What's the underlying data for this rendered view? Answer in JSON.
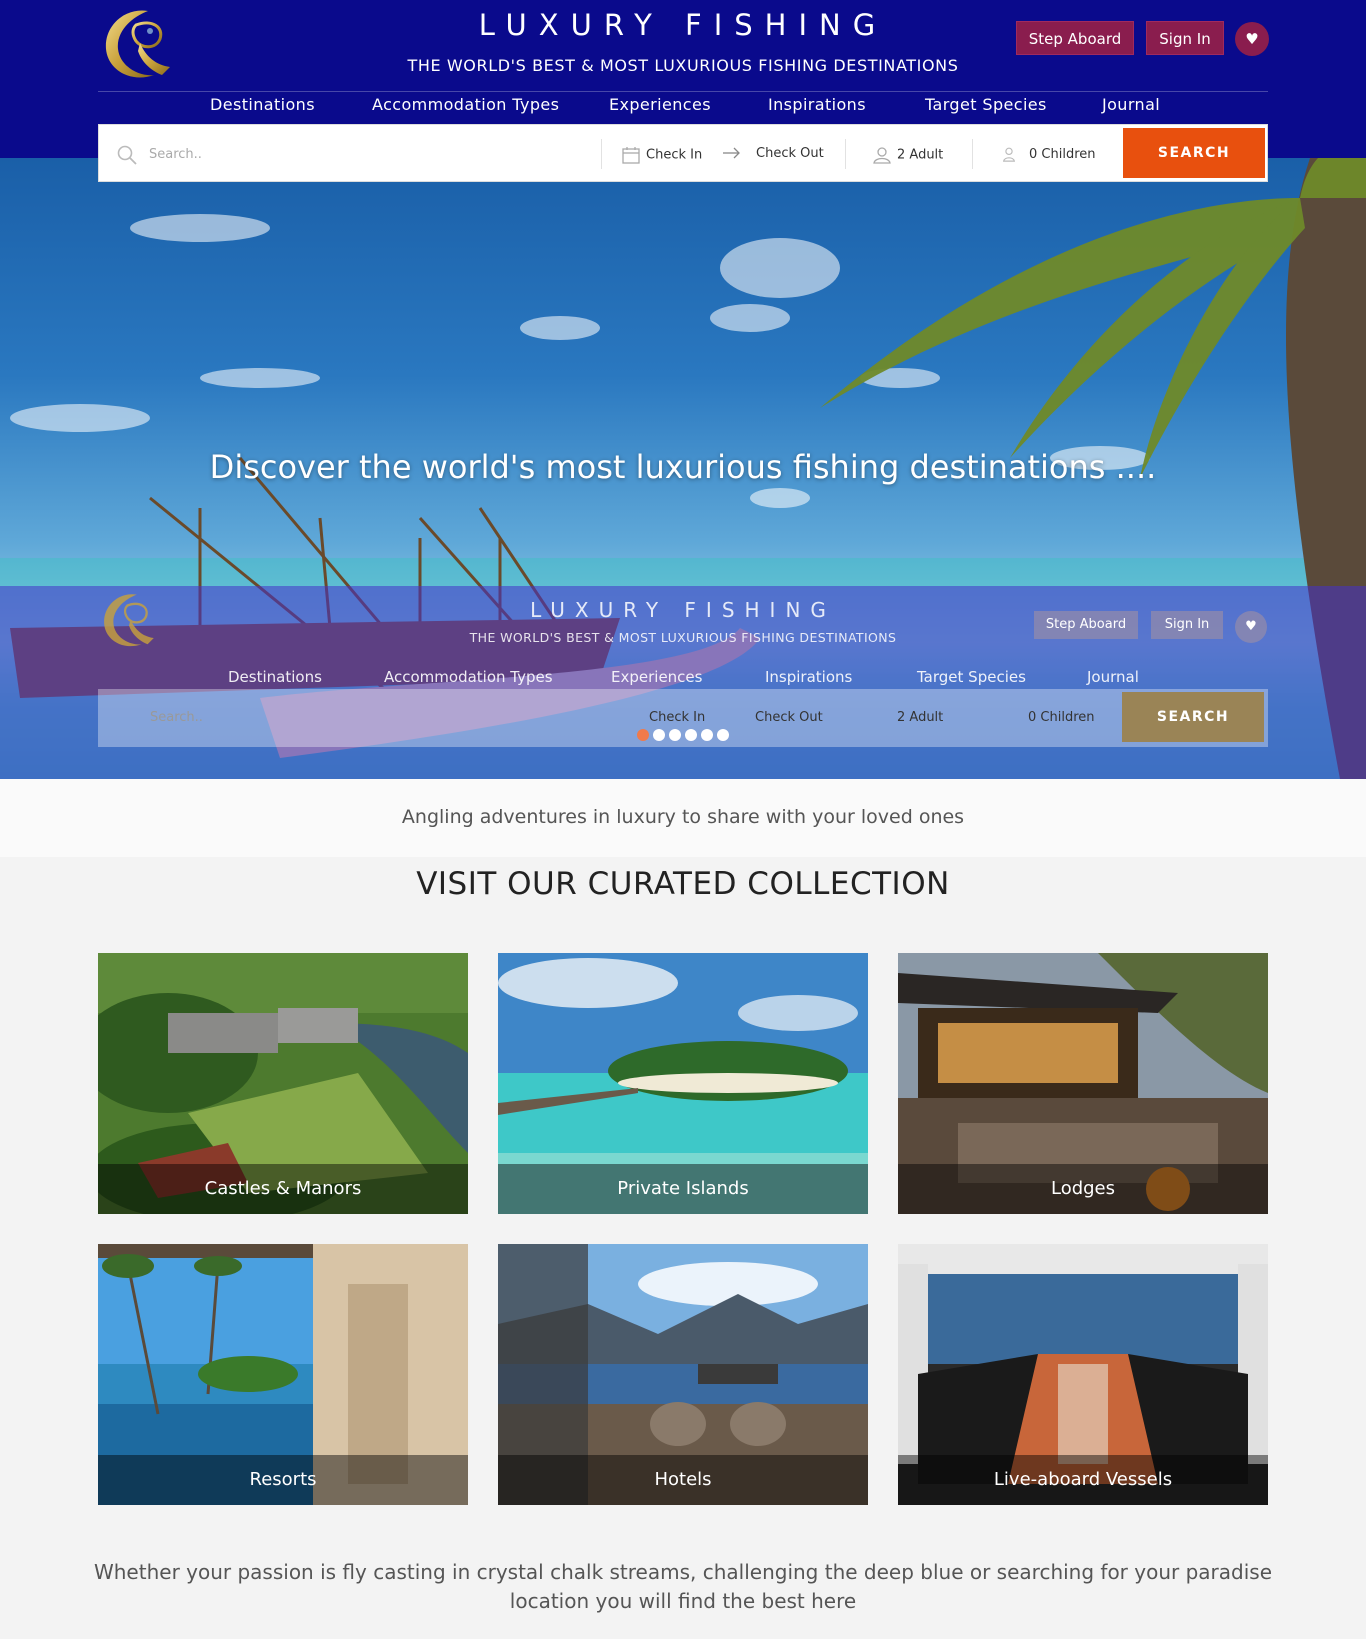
{
  "brand": {
    "title": "LUXURY FISHING",
    "subtitle": "THE WORLD'S BEST & MOST LUXURIOUS FISHING DESTINATIONS",
    "logo_icon": "fish-crest-logo-icon"
  },
  "header": {
    "step_aboard_label": "Step Aboard",
    "sign_in_label": "Sign In",
    "favorites_icon": "heart-icon"
  },
  "nav": {
    "items": [
      {
        "label": "Destinations"
      },
      {
        "label": "Accommodation Types"
      },
      {
        "label": "Experiences"
      },
      {
        "label": "Inspirations"
      },
      {
        "label": "Target Species"
      },
      {
        "label": "Journal"
      }
    ]
  },
  "search": {
    "placeholder": "Search..",
    "check_in": "Check In",
    "check_out": "Check Out",
    "adults": "2 Adult",
    "children": "0 Children",
    "button_label": "SEARCH"
  },
  "hero": {
    "heading": "Discover the world's most luxurious fishing destinations ....",
    "slide_count": 6,
    "active_slide": 1
  },
  "tagline": "Angling adventures in luxury to share with your loved ones",
  "collection": {
    "title": "VISIT OUR CURATED COLLECTION",
    "items": [
      {
        "label": "Castles & Manors"
      },
      {
        "label": "Private Islands"
      },
      {
        "label": "Lodges"
      },
      {
        "label": "Resorts"
      },
      {
        "label": "Hotels"
      },
      {
        "label": "Live-aboard Vessels"
      }
    ]
  },
  "footer_text": "Whether your passion is fly casting in crystal chalk streams, challenging the deep blue or searching for your paradise location you will find the best here",
  "colors": {
    "header_bg": "#0a0a8c",
    "accent_button": "#8a1d4e",
    "search_button": "#e8500e"
  }
}
